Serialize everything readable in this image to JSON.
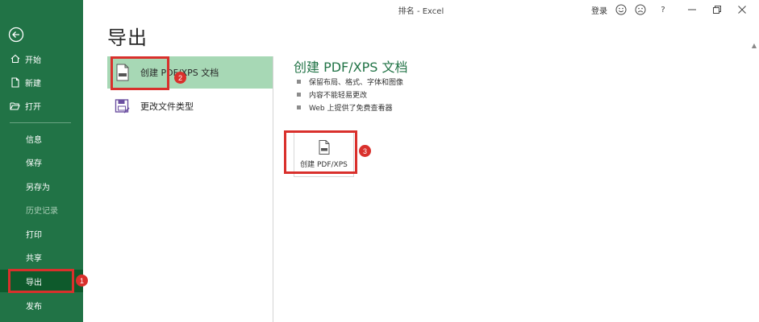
{
  "titlebar": {
    "title": "排名 - Excel",
    "login": "登录",
    "help": "?",
    "icons": [
      "smile-icon",
      "frown-icon",
      "help-icon",
      "minimize-icon",
      "restore-icon",
      "close-icon"
    ]
  },
  "sidebar": {
    "back_icon": "back-arrow-icon",
    "items": [
      {
        "label": "开始",
        "icon": "home-icon"
      },
      {
        "label": "新建",
        "icon": "new-file-icon"
      },
      {
        "label": "打开",
        "icon": "open-folder-icon"
      },
      {
        "label": "信息"
      },
      {
        "label": "保存"
      },
      {
        "label": "另存为"
      },
      {
        "label": "历史记录"
      },
      {
        "label": "打印"
      },
      {
        "label": "共享"
      },
      {
        "label": "导出"
      },
      {
        "label": "发布"
      }
    ]
  },
  "page": {
    "title": "导出"
  },
  "options": [
    {
      "label": "创建 PDF/XPS 文档",
      "icon": "pdf-document-icon"
    },
    {
      "label": "更改文件类型",
      "icon": "change-file-type-icon"
    }
  ],
  "detail": {
    "title": "创建 PDF/XPS 文档",
    "bullets": [
      "保留布局、格式、字体和图像",
      "内容不能轻易更改",
      "Web 上提供了免费查看器"
    ],
    "button_label": "创建 PDF/XPS"
  },
  "annotations": {
    "badge1": "1",
    "badge2": "2",
    "badge3": "3"
  },
  "colors": {
    "sidebar": "#217346",
    "sidebar_selected": "#0e5a2c",
    "option_selected": "#a7d8b5",
    "annotation_red": "#d9302c"
  }
}
